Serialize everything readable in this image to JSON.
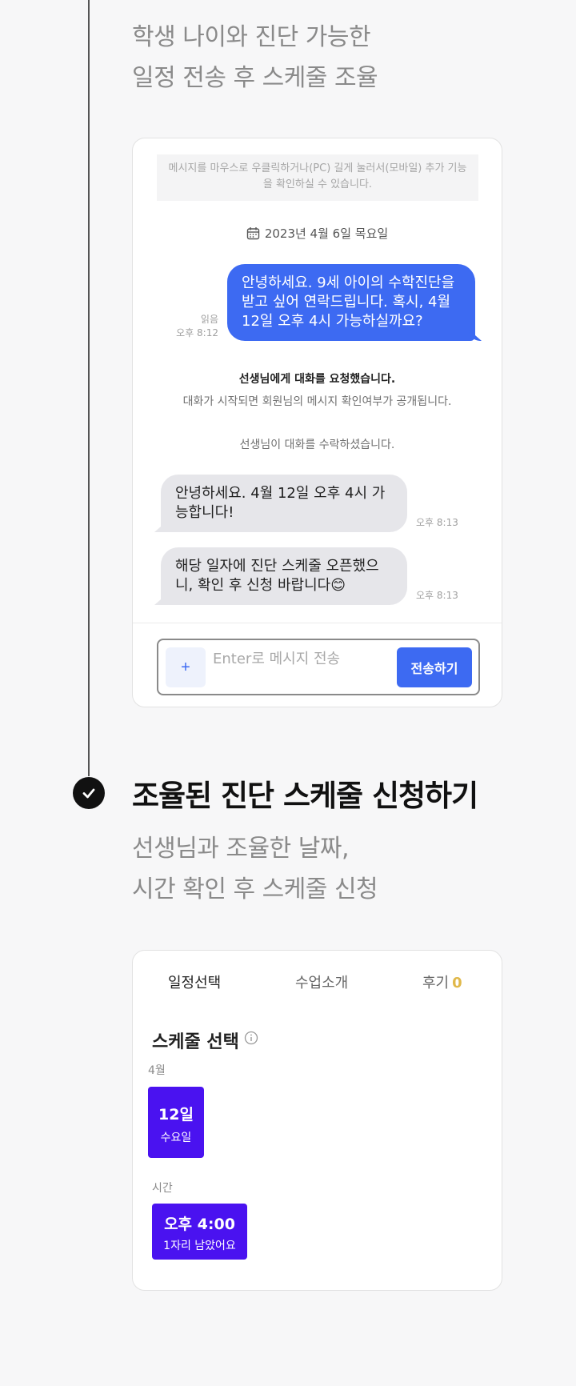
{
  "section1": {
    "subtitle_line1": "학생 나이와 진단 가능한",
    "subtitle_line2": "일정 전송 후 스케줄 조율"
  },
  "chat": {
    "notice": "메시지를 마우스로 우클릭하거나(PC) 길게 눌러서(모바일) 추가 기능을 확인하실 수 있습니다.",
    "date": "2023년 4월 6일 목요일",
    "my_message": "안녕하세요. 9세 아이의 수학진단을 받고 싶어 연락드립니다. 혹시, 4월 12일 오후 4시 가능하실까요?",
    "my_status": "읽음",
    "my_time": "오후 8:12",
    "system_bold": "선생님에게 대화를 요청했습니다.",
    "system_note": "대화가 시작되면 회원님의 메시지 확인여부가 공개됩니다.",
    "system_accept": "선생님이 대화를 수락하셨습니다.",
    "reply1": "안녕하세요. 4월 12일 오후 4시 가능합니다!",
    "reply1_time": "오후 8:13",
    "reply2": "해당 일자에 진단 스케줄 오픈했으니, 확인 후 신청 바랍니다😊",
    "reply2_time": "오후 8:13",
    "plus_label": "+",
    "input_placeholder": "Enter로 메시지 전송",
    "send_label": "전송하기"
  },
  "section2": {
    "title": "조율된 진단 스케줄 신청하기",
    "subtitle_line1": "선생님과 조율한 날짜,",
    "subtitle_line2": "시간 확인 후 스케줄 신청"
  },
  "schedule": {
    "tabs": [
      "일정선택",
      "수업소개",
      "후기"
    ],
    "review_count": "0",
    "title": "스케줄 선택",
    "month_label": "4월",
    "date_day": "12일",
    "date_weekday": "수요일",
    "time_label": "시간",
    "time_value": "오후 4:00",
    "seats_left": "1자리 남았어요"
  },
  "colors": {
    "accent_blue": "#3d6af2",
    "select_purple": "#4a12f0",
    "review_yellow": "#e0b84a"
  }
}
